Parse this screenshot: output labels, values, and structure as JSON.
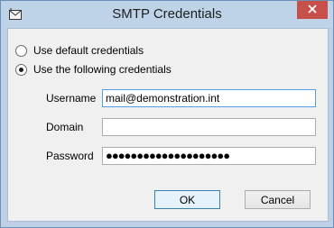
{
  "window": {
    "title": "SMTP Credentials",
    "icon": "mail-envelope-icon",
    "close_icon": "close-icon"
  },
  "options": [
    {
      "label": "Use default credentials",
      "selected": false
    },
    {
      "label": "Use the following credentials",
      "selected": true
    }
  ],
  "fields": {
    "username": {
      "label": "Username",
      "value": "mail@demonstration.int"
    },
    "domain": {
      "label": "Domain",
      "value": ""
    },
    "password": {
      "label": "Password",
      "value": "●●●●●●●●●●●●●●●●●●●●"
    }
  },
  "buttons": {
    "ok": "OK",
    "cancel": "Cancel"
  },
  "colors": {
    "frame": "#bdd0e6",
    "close_button": "#c7504a",
    "focus_border": "#569de5"
  }
}
